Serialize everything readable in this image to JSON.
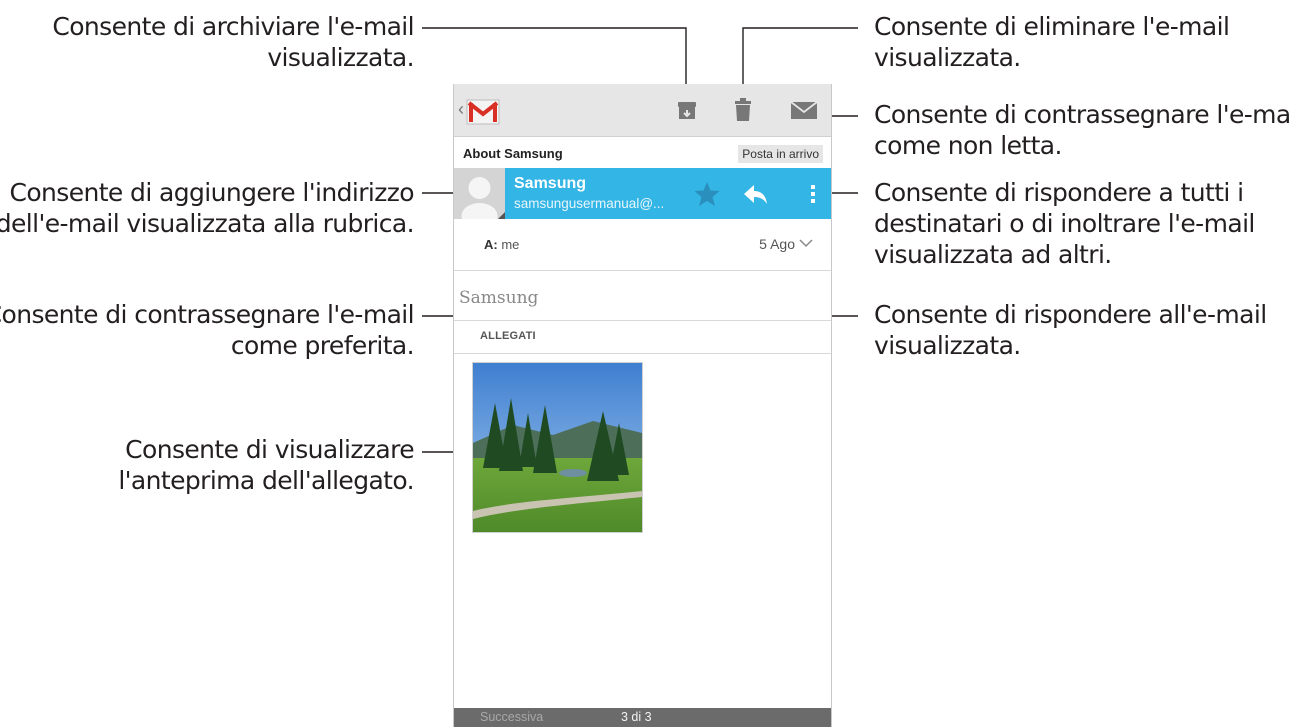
{
  "callouts": {
    "archive": [
      "Consente di archiviare l'e-mail",
      "visualizzata."
    ],
    "add_contact": [
      "Consente di aggiungere l'indirizzo",
      "dell'e-mail visualizzata alla rubrica."
    ],
    "favorite": [
      "Consente di contrassegnare l'e-mail",
      "come preferita."
    ],
    "preview": [
      "Consente di visualizzare",
      "l'anteprima dell'allegato."
    ],
    "delete": [
      "Consente di eliminare l'e-mail",
      "visualizzata."
    ],
    "mark_unread": [
      "Consente di contrassegnare l'e-mail",
      "come non letta."
    ],
    "reply_all_forward": [
      "Consente di rispondere a tutti i",
      "destinatari o di inoltrare l'e-mail",
      "visualizzata ad altri."
    ],
    "reply": [
      "Consente di rispondere all'e-mail",
      "visualizzata."
    ]
  },
  "screen": {
    "actionbar": {
      "back": "‹",
      "archive_icon": "archive-icon",
      "delete_icon": "trash-icon",
      "unread_icon": "envelope-icon"
    },
    "subject": "About Samsung",
    "folder_label": "Posta in arrivo",
    "sender": {
      "name": "Samsung",
      "email": "samsungusermanual@..."
    },
    "to": {
      "label": "A:",
      "value": "me"
    },
    "date": "5 Ago",
    "body": "Samsung",
    "attachments_label": "ALLEGATI",
    "bottom": {
      "next": "Successiva",
      "count": "3 di 3"
    }
  },
  "colors": {
    "sender_bar": "#33b5e5",
    "actionbar": "#e6e6e6",
    "icon": "#777777",
    "bottombar": "#6b6b6b"
  }
}
